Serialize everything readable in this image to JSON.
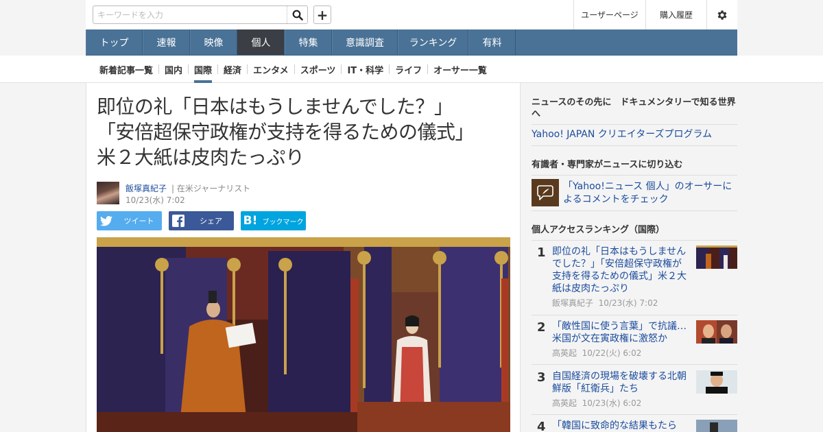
{
  "header": {
    "search_placeholder": "キーワードを入力",
    "add_label": "+",
    "user_page": "ユーザーページ",
    "purchase_history": "購入履歴"
  },
  "main_nav": [
    {
      "label": "トップ",
      "active": false
    },
    {
      "label": "速報",
      "active": false
    },
    {
      "label": "映像",
      "active": false
    },
    {
      "label": "個人",
      "active": true
    },
    {
      "label": "特集",
      "active": false
    },
    {
      "label": "意識調査",
      "active": false
    },
    {
      "label": "ランキング",
      "active": false
    },
    {
      "label": "有料",
      "active": false
    }
  ],
  "sub_nav": [
    {
      "label": "新着記事一覧",
      "active": false
    },
    {
      "label": "国内",
      "active": false
    },
    {
      "label": "国際",
      "active": true
    },
    {
      "label": "経済",
      "active": false
    },
    {
      "label": "エンタメ",
      "active": false
    },
    {
      "label": "スポーツ",
      "active": false
    },
    {
      "label": "IT・科学",
      "active": false
    },
    {
      "label": "ライフ",
      "active": false
    },
    {
      "label": "オーサー一覧",
      "active": false
    }
  ],
  "article": {
    "title_lines": [
      "即位の礼「日本はもうしませんでした？」",
      "「安倍超保守政権が支持を得るための儀式」",
      "米２大紙は皮肉たっぷり"
    ],
    "author": "飯塚真紀子",
    "author_role": "| 在米ジャーナリスト",
    "date": "10/23(水) 7:02",
    "share_twitter": "ツイート",
    "share_facebook": "シェア",
    "share_hatena": "ブックマーク"
  },
  "sidebar": {
    "promo_heading": "ニュースのその先に　ドキュメンタリーで知る世界へ",
    "promo_link": "Yahoo! JAPAN クリエイターズプログラム",
    "experts_heading": "有識者・専門家がニュースに切り込む",
    "experts_link": "「Yahoo!ニュース 個人」のオーサーによるコメントをチェック",
    "ranking_heading": "個人アクセスランキング（国際）",
    "ranking": [
      {
        "rank": "1",
        "title": "即位の礼「日本はもうしませんでした？」「安倍超保守政権が支持を得るための儀式」米２大紙は皮肉たっぷり",
        "author": "飯塚真紀子",
        "date": "10/23(水) 7:02"
      },
      {
        "rank": "2",
        "title": "「敵性国に使う言葉」で抗議… 米国が文在寅政権に激怒か",
        "author": "高英起",
        "date": "10/22(火) 6:02"
      },
      {
        "rank": "3",
        "title": "自国経済の現場を破壊する北朝鮮版「紅衛兵」たち",
        "author": "高英起",
        "date": "10/23(水) 6:02"
      },
      {
        "rank": "4",
        "title": "「韓国に致命的な結果もたら",
        "author": "",
        "date": ""
      }
    ]
  },
  "colors": {
    "nav_bg": "#4a7296",
    "nav_active": "#3b3f45",
    "link": "#1a4b9c",
    "twitter": "#55acee",
    "facebook": "#3b5998",
    "hatena": "#00a4de"
  }
}
